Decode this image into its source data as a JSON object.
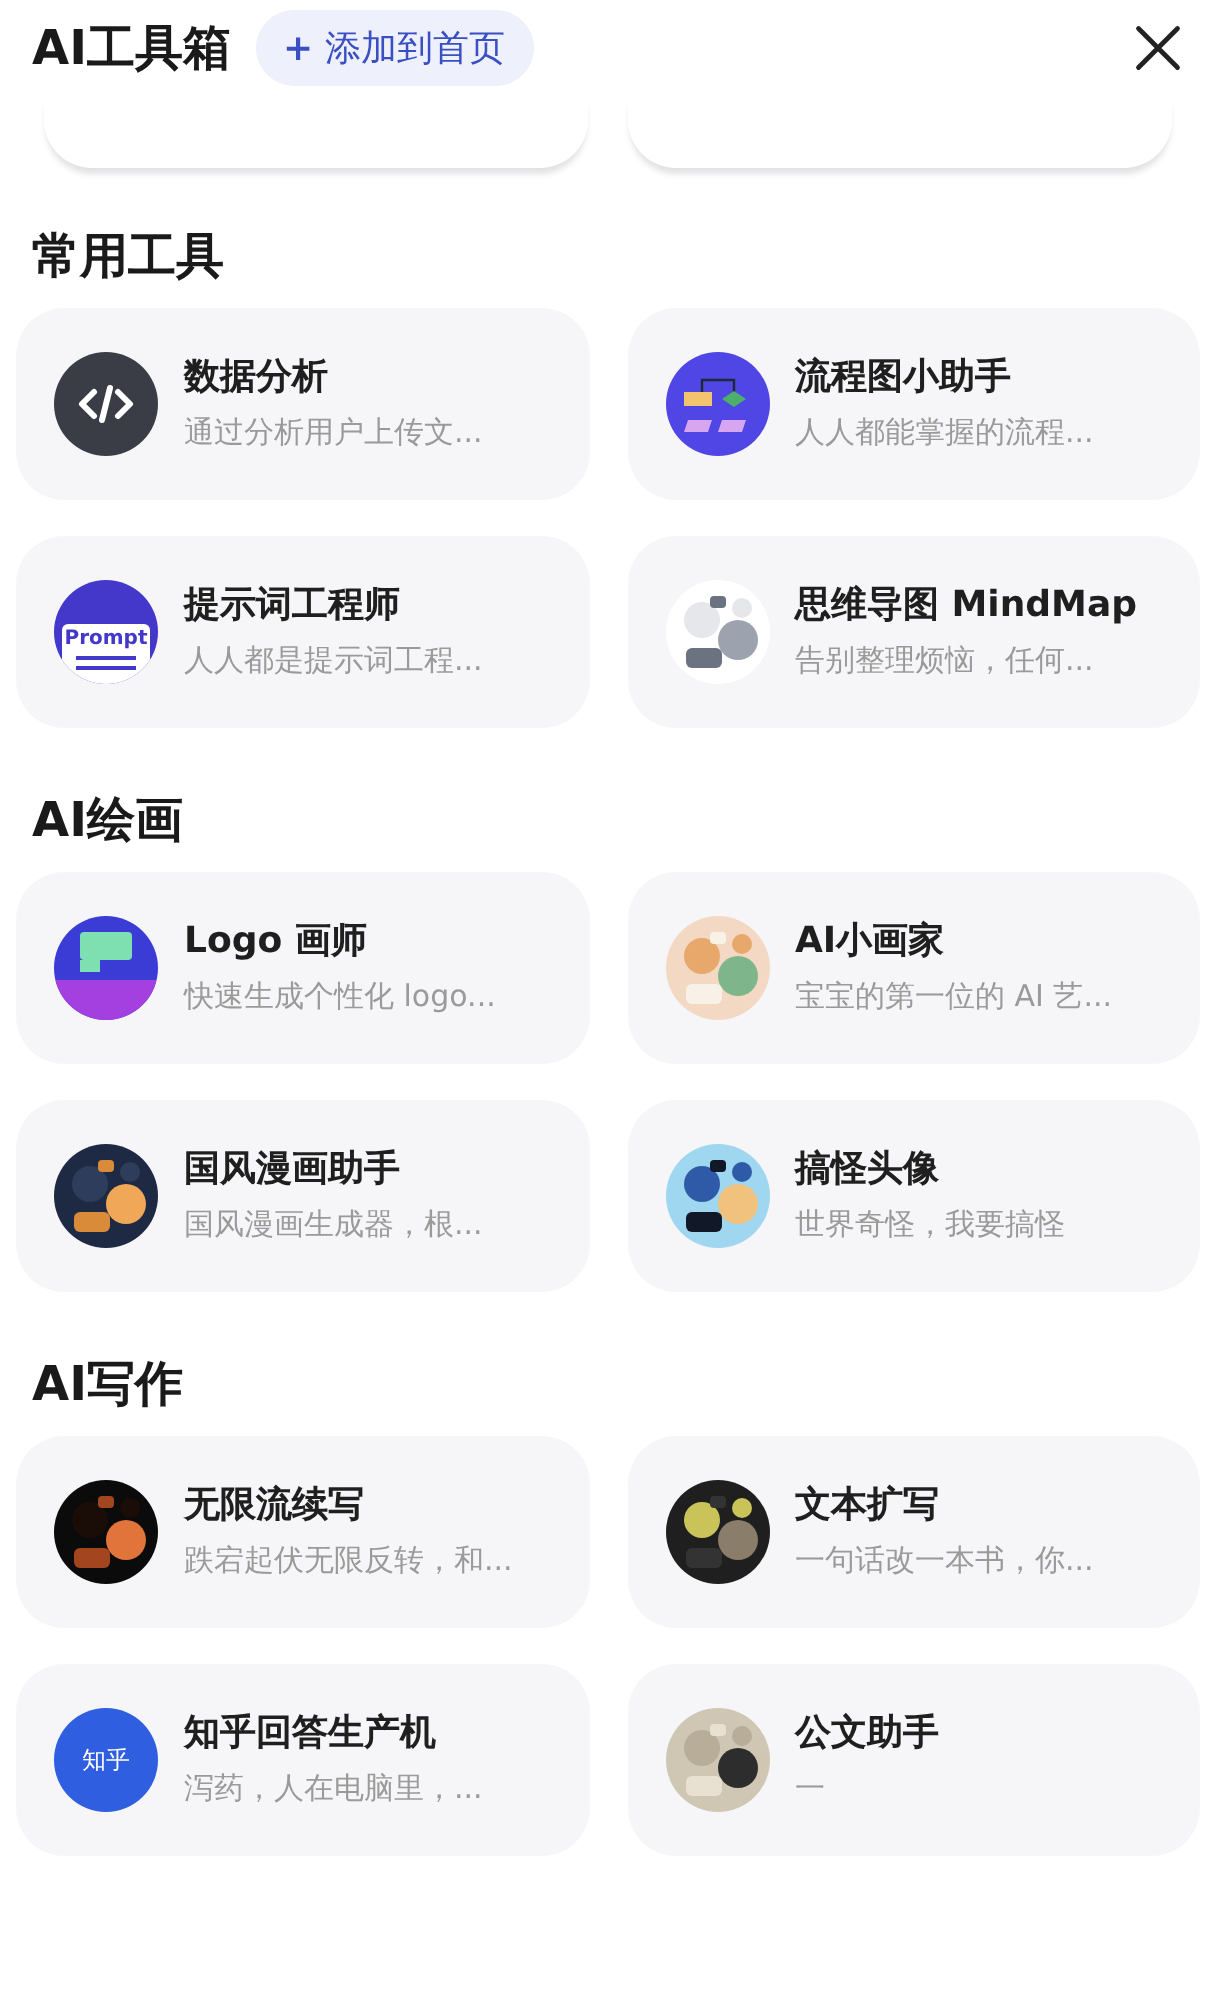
{
  "header": {
    "title": "AI工具箱",
    "add_button": {
      "icon": "+",
      "label": "添加到首页"
    }
  },
  "sections": [
    {
      "title": "常用工具",
      "tools": [
        {
          "name": "数据分析",
          "description": "通过分析用户上传文...",
          "icon": {
            "kind": "code"
          }
        },
        {
          "name": "流程图小助手",
          "description": "人人都能掌握的流程...",
          "icon": {
            "kind": "flowchart"
          }
        },
        {
          "name": "提示词工程师",
          "description": "人人都是提示词工程...",
          "icon": {
            "kind": "prompt",
            "text": "Prompt"
          }
        },
        {
          "name": "思维导图 MindMap",
          "description": "告别整理烦恼，任何..."
        }
      ]
    },
    {
      "title": "AI绘画",
      "tools": [
        {
          "name": "Logo 画师",
          "description": "快速生成个性化 logo...",
          "icon": {
            "kind": "logo"
          }
        },
        {
          "name": "AI小画家",
          "description": "宝宝的第一位的 AI 艺..."
        },
        {
          "name": "国风漫画助手",
          "description": "国风漫画生成器，根..."
        },
        {
          "name": "搞怪头像",
          "description": "世界奇怪，我要搞怪"
        }
      ]
    },
    {
      "title": "AI写作",
      "tools": [
        {
          "name": "无限流续写",
          "description": "跌宕起伏无限反转，和..."
        },
        {
          "name": "文本扩写",
          "description": "一句话改一本书，你..."
        },
        {
          "name": "知乎回答生产机",
          "description": "泻药，人在电脑里，...",
          "icon": {
            "kind": "badge",
            "text": "知乎"
          }
        },
        {
          "name": "公文助手",
          "description": "一"
        }
      ]
    }
  ]
}
